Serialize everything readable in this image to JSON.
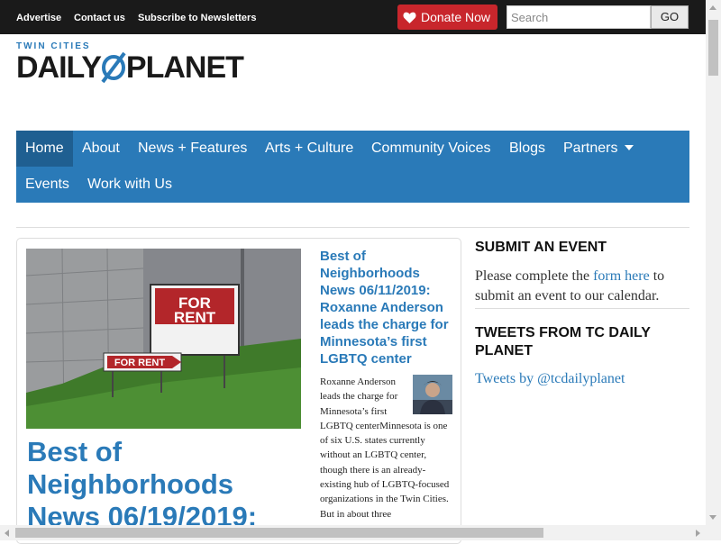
{
  "topbar": {
    "links": [
      "Advertise",
      "Contact us",
      "Subscribe to Newsletters"
    ],
    "donate_label": "Donate Now",
    "search_placeholder": "Search",
    "go_label": "GO"
  },
  "logo": {
    "small": "TWIN CITIES",
    "left": "DAILY",
    "right": "PLANET"
  },
  "nav": {
    "items": [
      "Home",
      "About",
      "News + Features",
      "Arts + Culture",
      "Community Voices",
      "Blogs",
      "Partners",
      "Events",
      "Work with Us"
    ],
    "active": "Home"
  },
  "feature": {
    "photo_sign_big": "FOR RENT",
    "photo_sign_small": "FOR RENT",
    "title": "Best of Neighborhoods News 06/19/2019:",
    "side_title": "Best of Neighborhoods News 06/11/2019: Roxanne Anderson leads the charge for Minnesota’s first LGBTQ center",
    "excerpt": "Roxanne Anderson leads the charge for Minnesota’s first LGBTQ centerMinnesota is one of six U.S. states currently without an LGBTQ center, though there is an already-existing hub of LGBTQ-focused organizations in the Twin Cities. But in about three"
  },
  "sidebar": {
    "submit_heading": "SUBMIT AN EVENT",
    "submit_text_before": "Please complete the ",
    "submit_link": "form here",
    "submit_text_after": " to submit an event to our calendar.",
    "tweets_heading": "TWEETS FROM TC DAILY PLANET",
    "tweets_link": "Tweets by @tcdailyplanet"
  },
  "colors": {
    "brand_blue": "#2a7ab8",
    "donate_red": "#c8262c",
    "topbar": "#1a1a1a"
  }
}
